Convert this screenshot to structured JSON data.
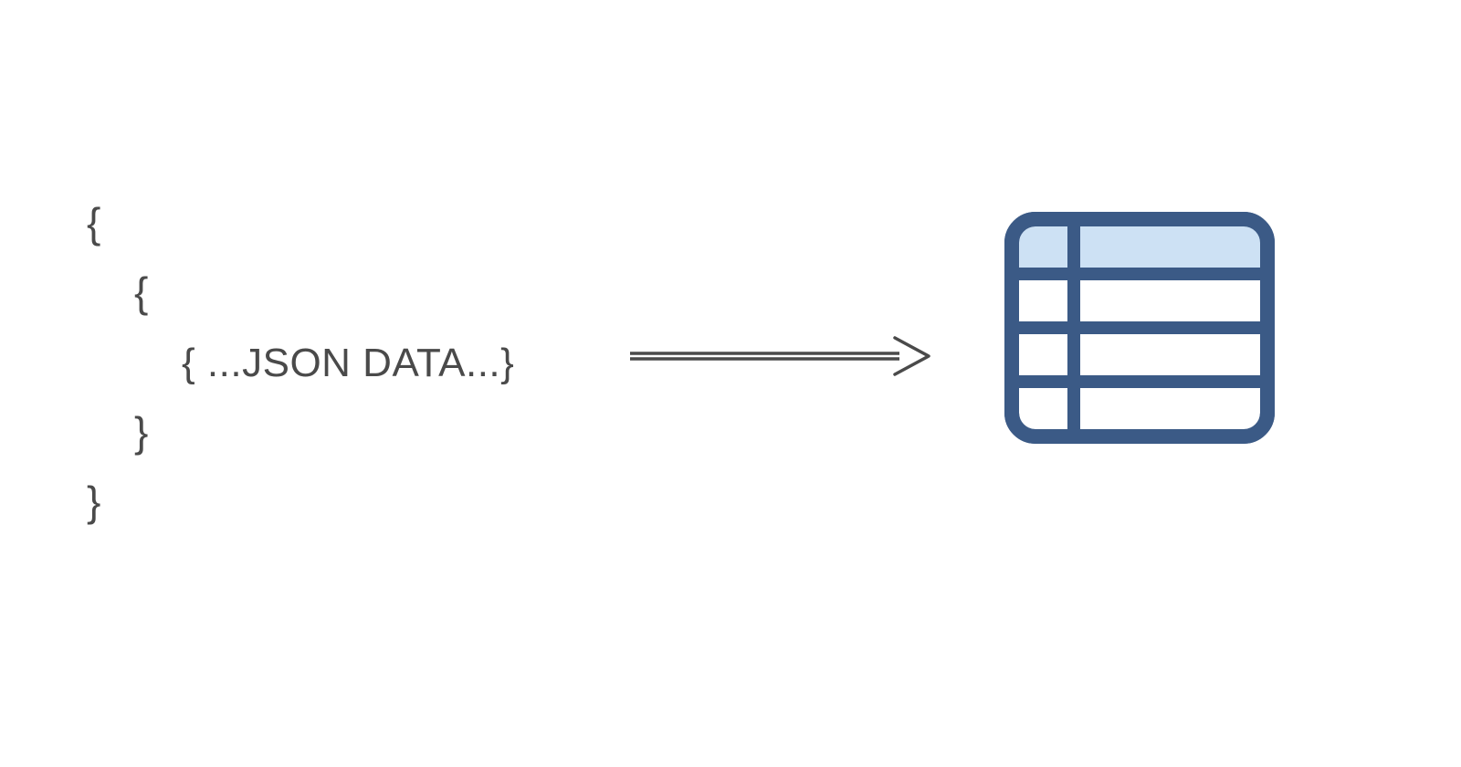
{
  "json_block": {
    "brace_open_1": "{",
    "brace_open_2": "{",
    "inner_text": "{ ...JSON DATA...}",
    "brace_close_2": "}",
    "brace_close_1": "}"
  },
  "arrow": {
    "semantic": "arrow-right"
  },
  "table_icon": {
    "semantic": "table-icon",
    "fill_header": "#cde1f4",
    "stroke": "#3b5a86"
  }
}
